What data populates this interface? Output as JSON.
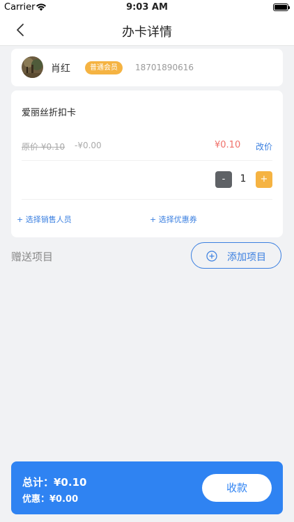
{
  "status_bar": {
    "carrier": "Carrier",
    "time": "9:03 AM"
  },
  "nav": {
    "title": "办卡详情"
  },
  "member": {
    "name": "肖红",
    "level_badge": "普通会员",
    "phone": "18701890616"
  },
  "card_detail": {
    "card_name": "爱丽丝折扣卡",
    "original_price": "原价 ¥0.10",
    "discount_amount": "-¥0.00",
    "final_price": "¥0.10",
    "edit_price_label": "改价",
    "quantity": "1",
    "minus_label": "-",
    "plus_label": "+",
    "select_staff_label": "+ 选择销售人员",
    "select_coupon_label": "+ 选择优惠券"
  },
  "gift": {
    "title": "赠送项目",
    "add_button_label": "添加项目"
  },
  "footer": {
    "total": "总计：¥0.10",
    "discount": "优惠：¥0.00",
    "pay_button_label": "收款"
  },
  "colors": {
    "accent_blue": "#2f83f2",
    "badge_orange": "#f5b342",
    "price_red": "#f0706a",
    "background": "#f1f2f4"
  }
}
